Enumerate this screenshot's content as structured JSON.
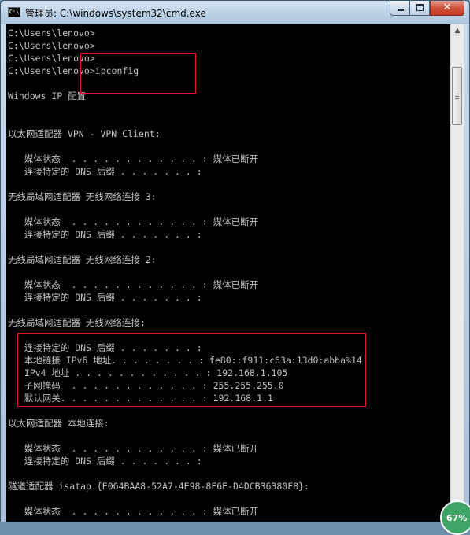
{
  "window": {
    "title": "管理员: C:\\windows\\system32\\cmd.exe",
    "icon_text": "C:\\",
    "controls": {
      "close_label": "✕"
    }
  },
  "console": {
    "lines": [
      "C:\\Users\\lenovo>",
      "C:\\Users\\lenovo>",
      "C:\\Users\\lenovo>",
      "C:\\Users\\lenovo>ipconfig",
      "",
      "Windows IP 配置",
      "",
      "",
      "以太网适配器 VPN - VPN Client:",
      "",
      "   媒体状态  . . . . . . . . . . . . : 媒体已断开",
      "   连接特定的 DNS 后缀 . . . . . . . :",
      "",
      "无线局域网适配器 无线网络连接 3:",
      "",
      "   媒体状态  . . . . . . . . . . . . : 媒体已断开",
      "   连接特定的 DNS 后缀 . . . . . . . :",
      "",
      "无线局域网适配器 无线网络连接 2:",
      "",
      "   媒体状态  . . . . . . . . . . . . : 媒体已断开",
      "   连接特定的 DNS 后缀 . . . . . . . :",
      "",
      "无线局域网适配器 无线网络连接:",
      "",
      "   连接特定的 DNS 后缀 . . . . . . . :",
      "   本地链接 IPv6 地址. . . . . . . . : fe80::f911:c63a:13d0:abba%14",
      "   IPv4 地址 . . . . . . . . . . . . : 192.168.1.105",
      "   子网掩码  . . . . . . . . . . . . : 255.255.255.0",
      "   默认网关. . . . . . . . . . . . . : 192.168.1.1",
      "",
      "以太网适配器 本地连接:",
      "",
      "   媒体状态  . . . . . . . . . . . . : 媒体已断开",
      "   连接特定的 DNS 后缀 . . . . . . . :",
      "",
      "隧道适配器 isatap.{E064BAA8-52A7-4E98-8F6E-D4DCB36380F8}:",
      "",
      "   媒体状态  . . . . . . . . . . . . : 媒体已断开"
    ]
  },
  "scrollbar": {
    "up_icon": "▲",
    "down_icon": "▼"
  },
  "overlay": {
    "badge_text": "67%"
  },
  "colors": {
    "console_bg": "#000000",
    "console_text": "#c0c0c0",
    "highlight": "#e0191b",
    "badge": "#3fa566"
  }
}
